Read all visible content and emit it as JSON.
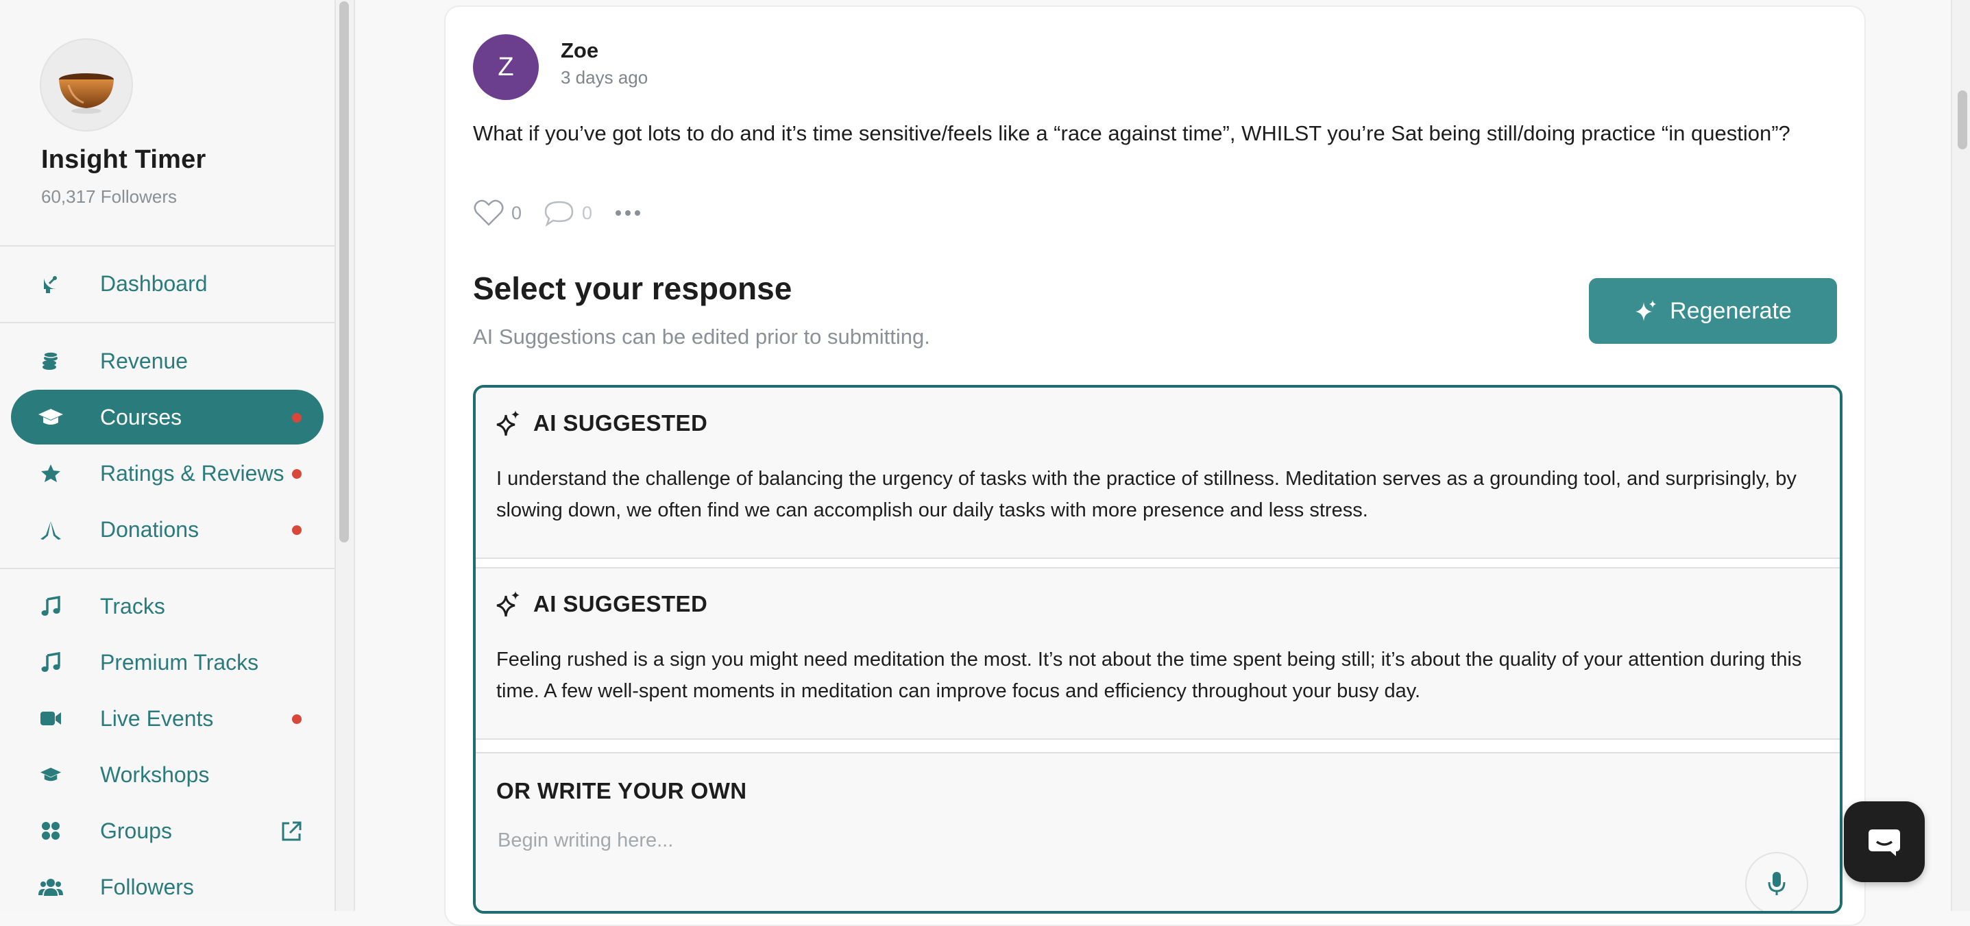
{
  "sidebar": {
    "org_name": "Insight Timer",
    "followers": "60,317 Followers",
    "nav": [
      {
        "label": "Dashboard",
        "icon": "satellite-dish-icon"
      },
      {
        "label": "Revenue",
        "icon": "coins-icon"
      },
      {
        "label": "Courses",
        "icon": "graduation-cap-icon",
        "active": true,
        "notification": true
      },
      {
        "label": "Ratings & Reviews",
        "icon": "star-icon",
        "notification": true
      },
      {
        "label": "Donations",
        "icon": "hands-icon",
        "notification": true
      },
      {
        "label": "Tracks",
        "icon": "music-note-icon"
      },
      {
        "label": "Premium Tracks",
        "icon": "music-note-icon"
      },
      {
        "label": "Live Events",
        "icon": "video-camera-icon",
        "notification": true
      },
      {
        "label": "Workshops",
        "icon": "graduation-cap-icon"
      },
      {
        "label": "Groups",
        "icon": "groups-icon",
        "external": true
      },
      {
        "label": "Followers",
        "icon": "users-icon"
      }
    ]
  },
  "post": {
    "avatar_initial": "Z",
    "author": "Zoe",
    "time": "3 days ago",
    "text": "What if you’ve got lots to do and it’s time sensitive/feels like a “race against time”, WHILST you’re Sat being still/doing practice “in question”?",
    "likes": "0",
    "comments": "0"
  },
  "response": {
    "title": "Select your response",
    "subtitle": "AI Suggestions can be edited prior to submitting.",
    "regenerate_label": "Regenerate",
    "suggestions": [
      {
        "label": "AI SUGGESTED",
        "text": "I understand the challenge of balancing the urgency of tasks with the practice of stillness. Meditation serves as a grounding tool, and surprisingly, by slowing down, we often find we can accomplish our daily tasks with more presence and less stress."
      },
      {
        "label": "AI SUGGESTED",
        "text": "Feeling rushed is a sign you might need meditation the most. It’s not about the time spent being still; it’s about the quality of your attention during this time. A few well-spent moments in meditation can improve focus and efficiency throughout your busy day."
      }
    ],
    "own_title": "OR WRITE YOUR OWN",
    "own_placeholder": "Begin writing here..."
  },
  "colors": {
    "accent": "#2a7b7c",
    "button": "#3a8e8f",
    "avatar": "#6b3f8d",
    "notification": "#d9473b"
  }
}
